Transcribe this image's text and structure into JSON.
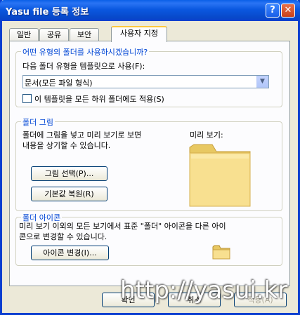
{
  "window": {
    "title": "Yasu file 등록 정보"
  },
  "tabs": [
    {
      "label": "일반"
    },
    {
      "label": "공유"
    },
    {
      "label": "보안"
    },
    {
      "label": "사용자 지정",
      "active": true
    }
  ],
  "folder_type_group": {
    "legend": "어떤 유형의 폴더를 사용하시겠습니까?",
    "template_label": "다음 폴더 유형을 템플릿으로 사용(F):",
    "template_value": "문서(모든 파일 형식)",
    "apply_subfolders_label": "이 템플릿을 모든 하위 폴더에도 적용(S)",
    "apply_subfolders_checked": false
  },
  "folder_picture_group": {
    "legend": "폴더 그림",
    "description_line1": "폴더에 그림을 넣고 미리 보기로 보면",
    "description_line2": "내용을 상기할 수 있습니다.",
    "preview_label": "미리 보기:",
    "choose_picture_button": "그림 선택(P)...",
    "restore_default_button": "기본값 복원(R)"
  },
  "folder_icon_group": {
    "legend": "폴더 아이콘",
    "description_line1": "미리 보기 이외의 모든 보기에서 표준 \"폴더\" 아이콘을 다른 아이",
    "description_line2": "콘으로 변경할 수 있습니다.",
    "change_icon_button": "아이콘 변경(I)..."
  },
  "footer": {
    "ok_button": "확인",
    "cancel_button": "취소",
    "apply_button": "적용(A)"
  },
  "watermark": "http://yasui.kr",
  "colors": {
    "title_bar": "#0a58e0",
    "accent_legend": "#0046d5",
    "folder": "#f5dc7a"
  }
}
